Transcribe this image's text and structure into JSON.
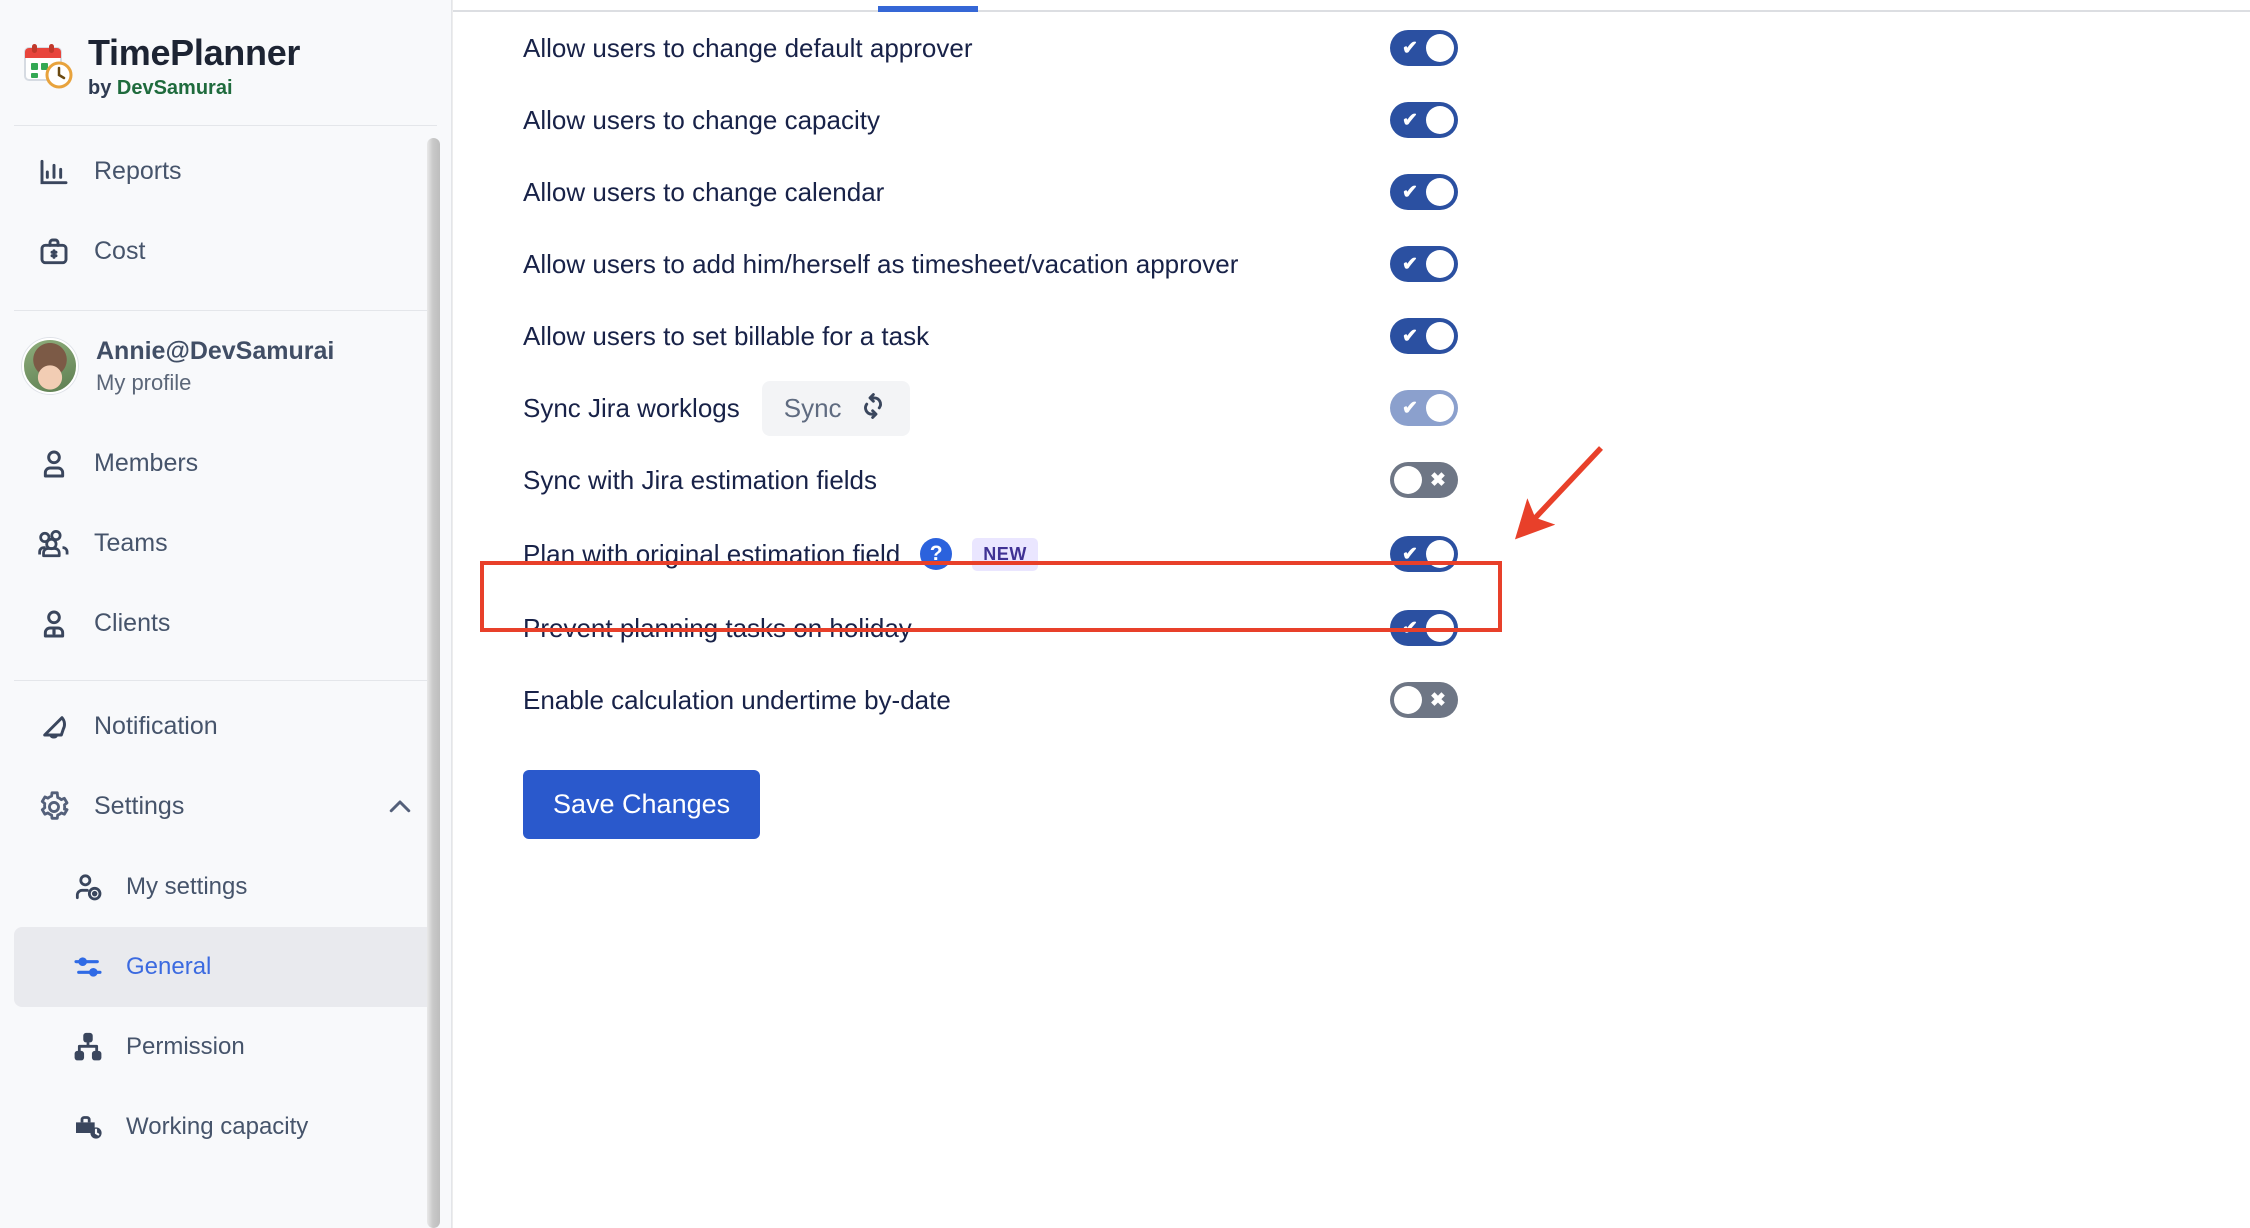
{
  "sidebar": {
    "brand": {
      "title": "TimePlanner",
      "by_prefix": "by ",
      "by_name": "DevSamurai",
      "logo_icon": "calendar-clock-icon"
    },
    "top_items": [
      {
        "label": "Reports",
        "icon": "bar-chart-icon"
      },
      {
        "label": "Cost",
        "icon": "briefcase-dollar-icon"
      }
    ],
    "profile": {
      "name": "Annie@DevSamurai",
      "link": "My profile",
      "avatar_icon": "avatar"
    },
    "mid_items": [
      {
        "label": "Members",
        "icon": "user-icon"
      },
      {
        "label": "Teams",
        "icon": "users-group-icon"
      },
      {
        "label": "Clients",
        "icon": "user-lock-icon"
      }
    ],
    "bottom_items": [
      {
        "label": "Notification",
        "icon": "bell-icon"
      }
    ],
    "settings": {
      "label": "Settings",
      "icon": "gear-icon",
      "chevron": "chevron-up-icon",
      "expanded": true
    },
    "settings_children": [
      {
        "label": "My settings",
        "icon": "user-cog-icon",
        "selected": false
      },
      {
        "label": "General",
        "icon": "sliders-icon",
        "selected": true
      },
      {
        "label": "Permission",
        "icon": "org-chart-icon",
        "selected": false
      },
      {
        "label": "Working capacity",
        "icon": "briefcase-clock-icon",
        "selected": false
      }
    ]
  },
  "main": {
    "settings_rows": [
      {
        "label": "Allow users to change default approver",
        "toggle": "on"
      },
      {
        "label": "Allow users to change capacity",
        "toggle": "on"
      },
      {
        "label": "Allow users to change calendar",
        "toggle": "on"
      },
      {
        "label": "Allow users to add him/herself as timesheet/vacation approver",
        "toggle": "on"
      },
      {
        "label": "Allow users to set billable for a task",
        "toggle": "on"
      },
      {
        "label": "Sync Jira worklogs",
        "toggle": "on-muted",
        "sync_button": "Sync",
        "sync_icon": "refresh-icon"
      },
      {
        "label": "Sync with Jira estimation fields",
        "toggle": "off"
      },
      {
        "label": "Plan with original estimation field",
        "toggle": "on",
        "help_icon": "question-mark-icon",
        "badge": "NEW",
        "highlighted": true
      },
      {
        "label": "Prevent planning tasks on holiday",
        "toggle": "on"
      },
      {
        "label": "Enable calculation undertime by-date",
        "toggle": "off"
      }
    ],
    "save_label": "Save Changes"
  },
  "annotation": {
    "highlight_color": "#e8402a",
    "arrow_icon": "arrow-pointer"
  },
  "colors": {
    "accent_blue": "#2a59cc",
    "toggle_on": "#2b50a1",
    "toggle_on_muted": "#8ba0cd",
    "toggle_off": "#6e7685",
    "badge_bg": "#eae6ff",
    "badge_text": "#403294",
    "brand_green": "#1f6b3d"
  }
}
